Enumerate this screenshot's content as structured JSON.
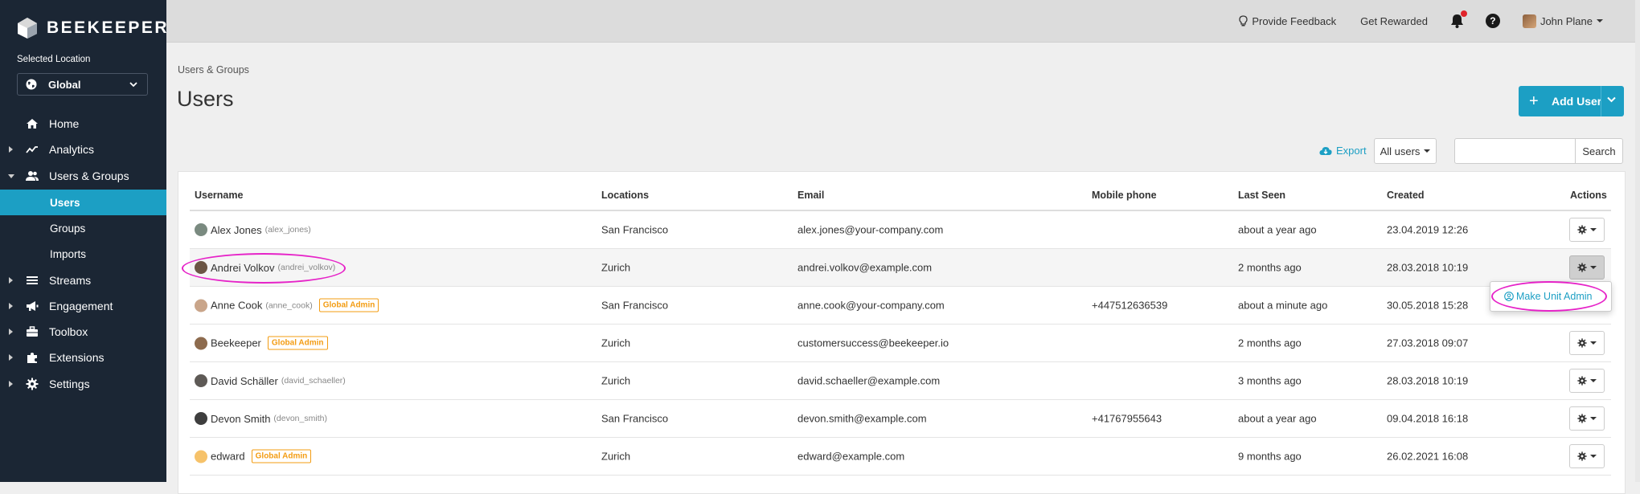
{
  "app": {
    "name": "BEEKEEPER"
  },
  "sidebar": {
    "location_label": "Selected Location",
    "location_value": "Global",
    "items": [
      {
        "label": "Home",
        "icon": "home-icon",
        "caret": "none"
      },
      {
        "label": "Analytics",
        "icon": "analytics-icon",
        "caret": "right"
      },
      {
        "label": "Users & Groups",
        "icon": "users-icon",
        "caret": "down"
      },
      {
        "label": "Streams",
        "icon": "streams-icon",
        "caret": "right"
      },
      {
        "label": "Engagement",
        "icon": "megaphone-icon",
        "caret": "right"
      },
      {
        "label": "Toolbox",
        "icon": "toolbox-icon",
        "caret": "right"
      },
      {
        "label": "Extensions",
        "icon": "puzzle-icon",
        "caret": "right"
      },
      {
        "label": "Settings",
        "icon": "gear-icon",
        "caret": "right"
      }
    ],
    "subitems": [
      {
        "label": "Users",
        "active": true
      },
      {
        "label": "Groups",
        "active": false
      },
      {
        "label": "Imports",
        "active": false
      }
    ]
  },
  "topbar": {
    "feedback": "Provide Feedback",
    "rewarded": "Get Rewarded",
    "user": "John Plane",
    "help": "?"
  },
  "page": {
    "breadcrumb": "Users & Groups",
    "title": "Users",
    "add_user": "Add User",
    "export": "Export",
    "filter": "All users",
    "search_placeholder": "",
    "search_button": "Search"
  },
  "table": {
    "headers": [
      "Username",
      "Locations",
      "Email",
      "Mobile phone",
      "Last Seen",
      "Created",
      "Actions"
    ],
    "rows": [
      {
        "name": "Alex Jones",
        "handle": "(alex_jones)",
        "badge": "",
        "location": "San Francisco",
        "email": "alex.jones@your-company.com",
        "phone": "",
        "last_seen": "about a year ago",
        "created": "23.04.2019 12:26"
      },
      {
        "name": "Andrei Volkov",
        "handle": "(andrei_volkov)",
        "badge": "",
        "location": "Zurich",
        "email": "andrei.volkov@example.com",
        "phone": "",
        "last_seen": "2 months ago",
        "created": "28.03.2018 10:19"
      },
      {
        "name": "Anne Cook",
        "handle": "(anne_cook)",
        "badge": "Global Admin",
        "location": "San Francisco",
        "email": "anne.cook@your-company.com",
        "phone": "+447512636539",
        "last_seen": "about a minute ago",
        "created": "30.05.2018 15:28"
      },
      {
        "name": "Beekeeper",
        "handle": "",
        "badge": "Global Admin",
        "location": "Zurich",
        "email": "customersuccess@beekeeper.io",
        "phone": "",
        "last_seen": "2 months ago",
        "created": "27.03.2018 09:07"
      },
      {
        "name": "David Schäller",
        "handle": "(david_schaeller)",
        "badge": "",
        "location": "Zurich",
        "email": "david.schaeller@example.com",
        "phone": "",
        "last_seen": "3 months ago",
        "created": "28.03.2018 10:19"
      },
      {
        "name": "Devon Smith",
        "handle": "(devon_smith)",
        "badge": "",
        "location": "San Francisco",
        "email": "devon.smith@example.com",
        "phone": "+41767955643",
        "last_seen": "about a year ago",
        "created": "09.04.2018 16:18"
      },
      {
        "name": "edward",
        "handle": "",
        "badge": "Global Admin",
        "location": "Zurich",
        "email": "edward@example.com",
        "phone": "",
        "last_seen": "9 months ago",
        "created": "26.02.2021 16:08"
      }
    ]
  },
  "dropdown": {
    "item": "Make Unit Admin"
  },
  "colors": {
    "accent": "#1c9fc4",
    "sidebar": "#1b2634",
    "badge": "#f39c12",
    "highlight": "#e623c8"
  }
}
